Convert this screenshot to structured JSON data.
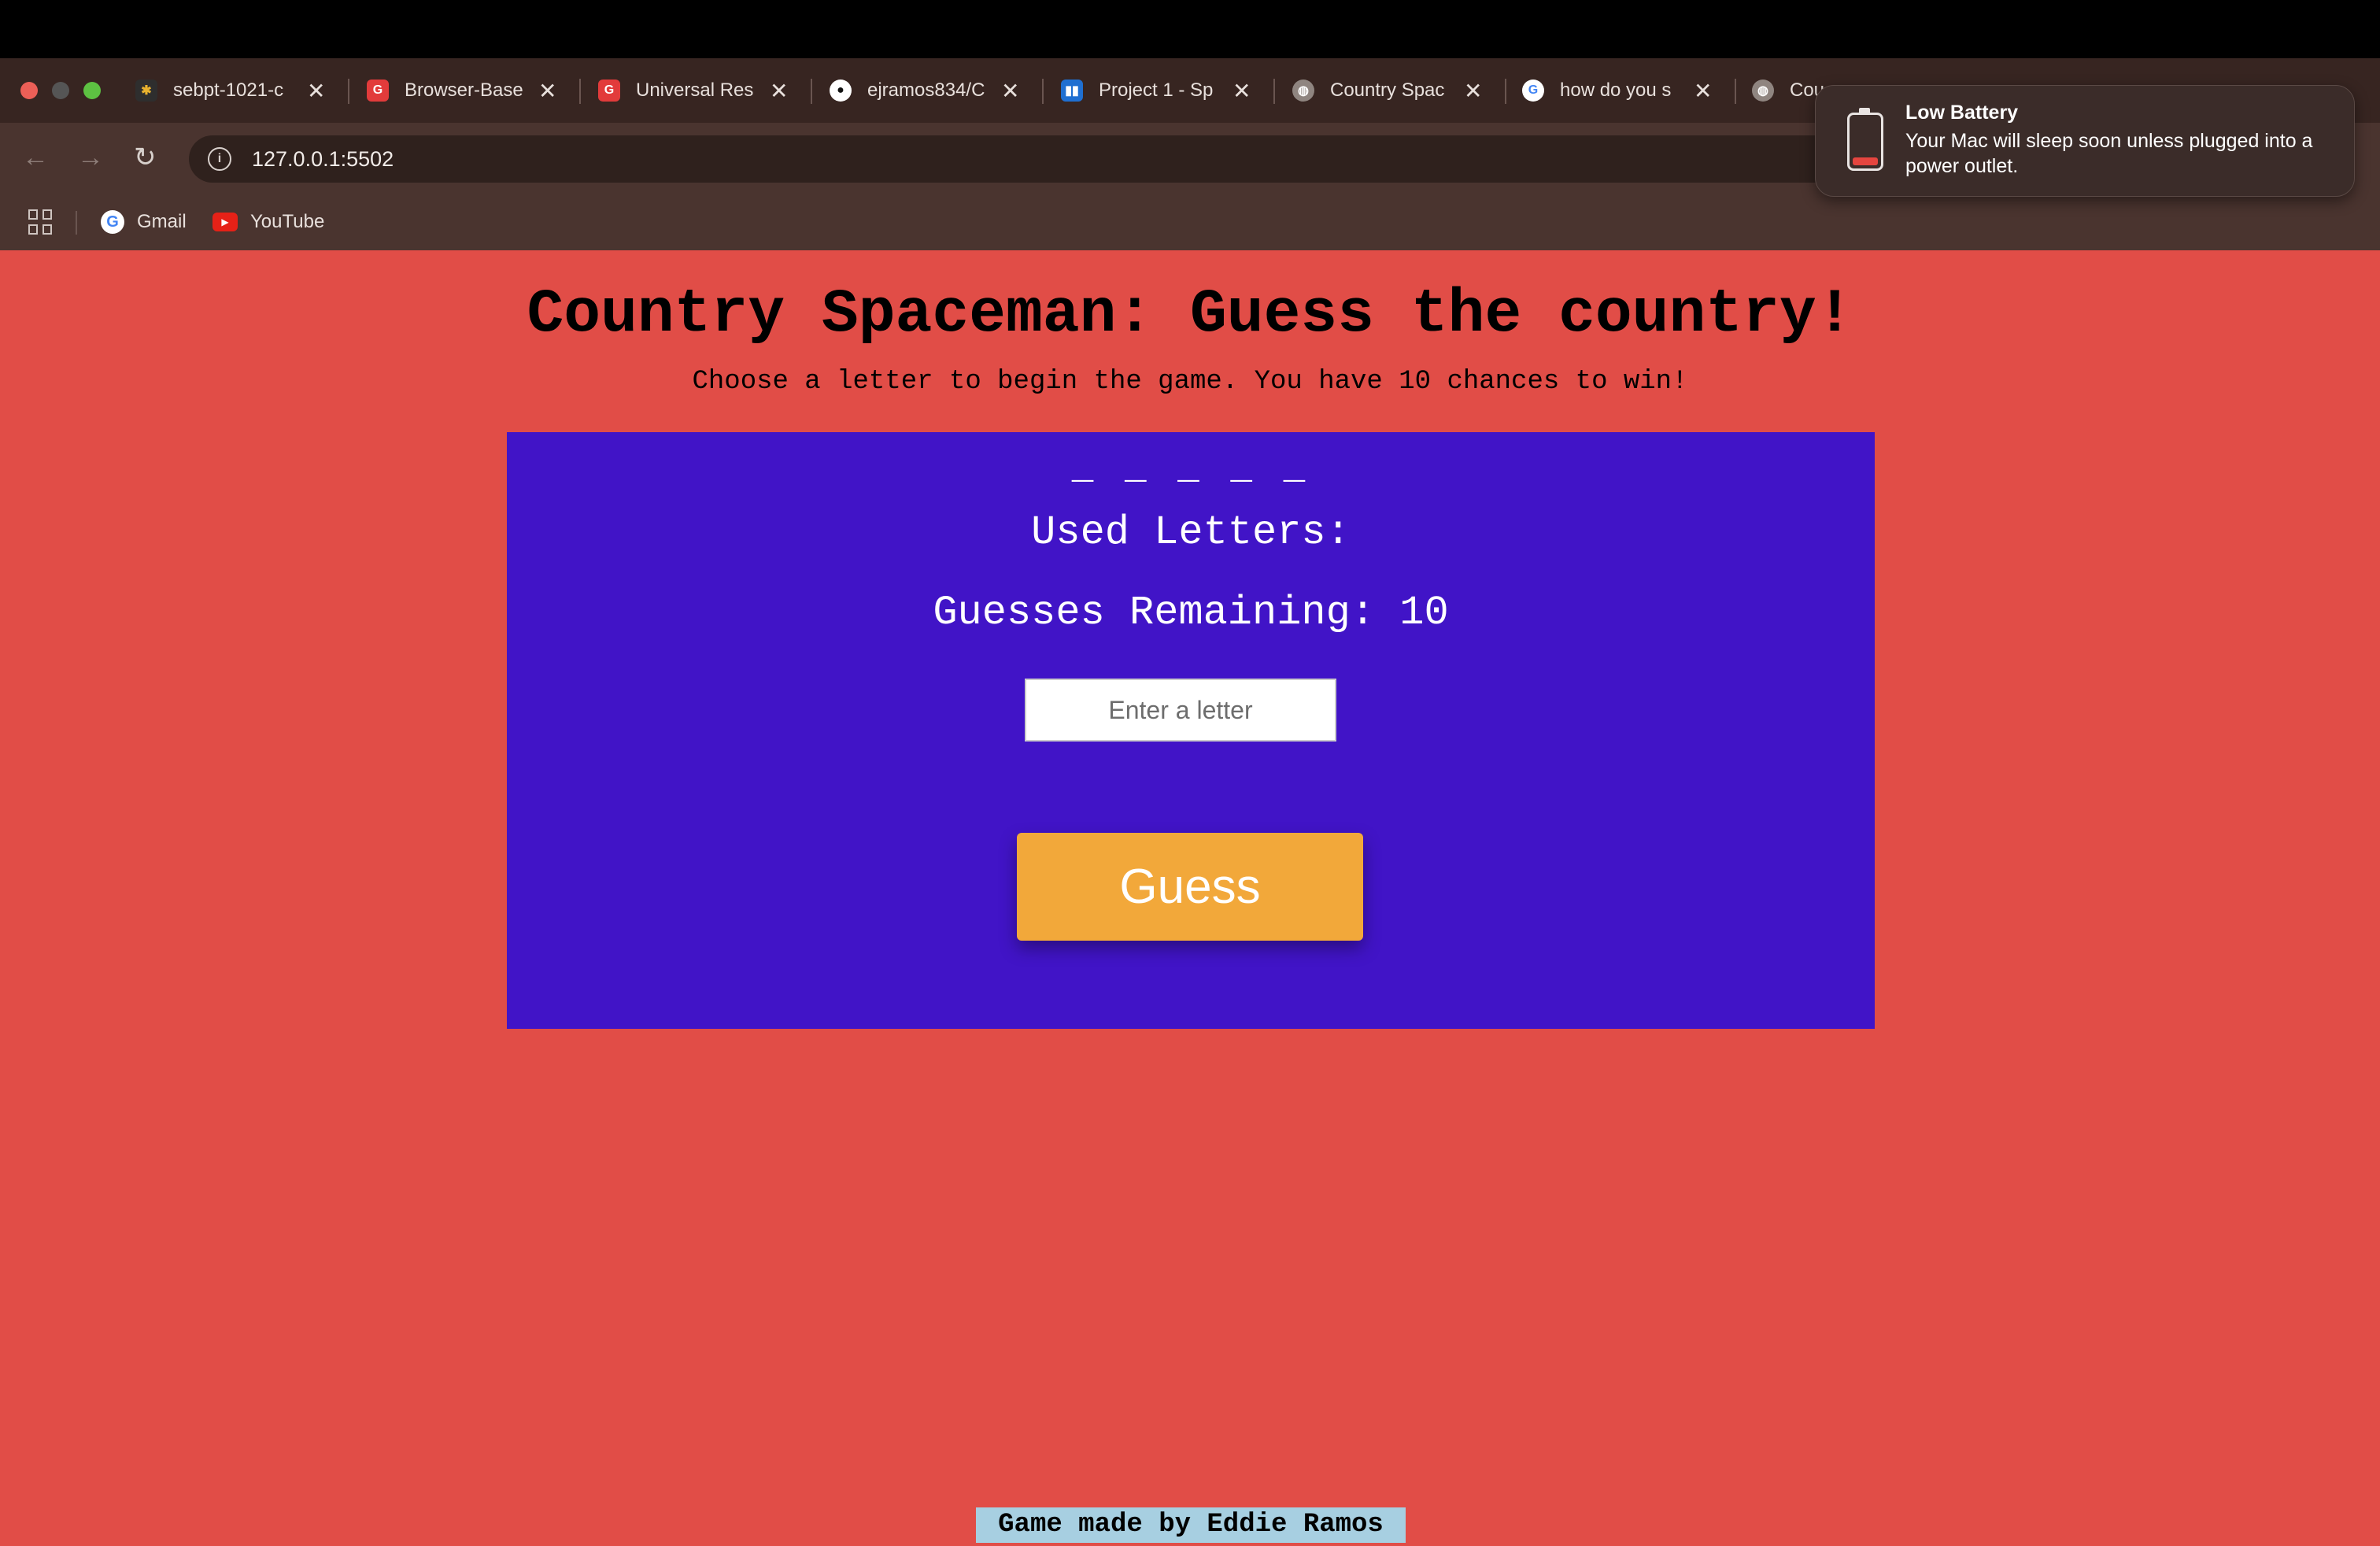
{
  "browser": {
    "tabs": [
      {
        "title": "sebpt-1021-c",
        "icon": "slack-icon"
      },
      {
        "title": "Browser-Base",
        "icon": "ga-icon"
      },
      {
        "title": "Universal Res",
        "icon": "ga-icon"
      },
      {
        "title": "ejramos834/C",
        "icon": "github-icon"
      },
      {
        "title": "Project 1 - Sp",
        "icon": "trello-icon"
      },
      {
        "title": "Country Spac",
        "icon": "globe-icon"
      },
      {
        "title": "how do you s",
        "icon": "google-icon"
      },
      {
        "title": "Cou",
        "icon": "globe-icon"
      }
    ],
    "url": "127.0.0.1:5502",
    "bookmarks": [
      {
        "label": "Gmail",
        "icon": "google-icon"
      },
      {
        "label": "YouTube",
        "icon": "youtube-icon"
      }
    ]
  },
  "notification": {
    "title": "Low Battery",
    "body": "Your Mac will sleep soon unless plugged into a power outlet.",
    "icon": "low-battery-icon"
  },
  "game": {
    "title": "Country Spaceman: Guess the country!",
    "instructions": "Choose a letter to begin the game. You have 10 chances to win!",
    "word_blanks": "_ _ _ _ _",
    "used_letters_label": "Used Letters:",
    "guesses_remaining_label": "Guesses Remaining: 10",
    "input_placeholder": "Enter a letter",
    "guess_button": "Guess",
    "footer": "Game made by Eddie Ramos"
  },
  "colors": {
    "page_background": "#e14d47",
    "panel_background": "#4114c7",
    "button": "#f2a83a",
    "footer_highlight": "#a7cfe1"
  }
}
